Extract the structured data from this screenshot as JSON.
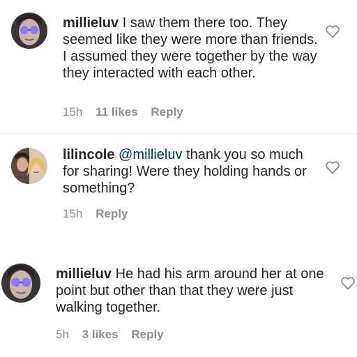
{
  "comments": [
    {
      "username": "millieluv",
      "mention": "",
      "text": "I saw them there too. They seemed like they were more than friends. I assumed they were together by the way they interacted with each other.",
      "time": "15h",
      "likes": "11 likes",
      "reply": "Reply",
      "avatar_icon": "user-avatar-purple-glasses",
      "heart_icon": "heart-outline-icon"
    },
    {
      "username": "lilincole",
      "mention": "@millieluv",
      "text": "thank you so much for sharing! Were they holding hands or something?",
      "time": "15h",
      "likes": "",
      "reply": "Reply",
      "avatar_icon": "user-avatar-two-people",
      "heart_icon": "heart-outline-icon"
    },
    {
      "username": "millieluv",
      "mention": "",
      "text": "He had his arm around her at one point but other than that they were just walking together.",
      "time": "5h",
      "likes": "3 likes",
      "reply": "Reply",
      "avatar_icon": "user-avatar-purple-glasses",
      "heart_icon": "heart-outline-icon"
    }
  ],
  "colors": {
    "text": "#262626",
    "meta": "#8e8e8e",
    "mention": "#003569",
    "divider": "#efefef"
  }
}
